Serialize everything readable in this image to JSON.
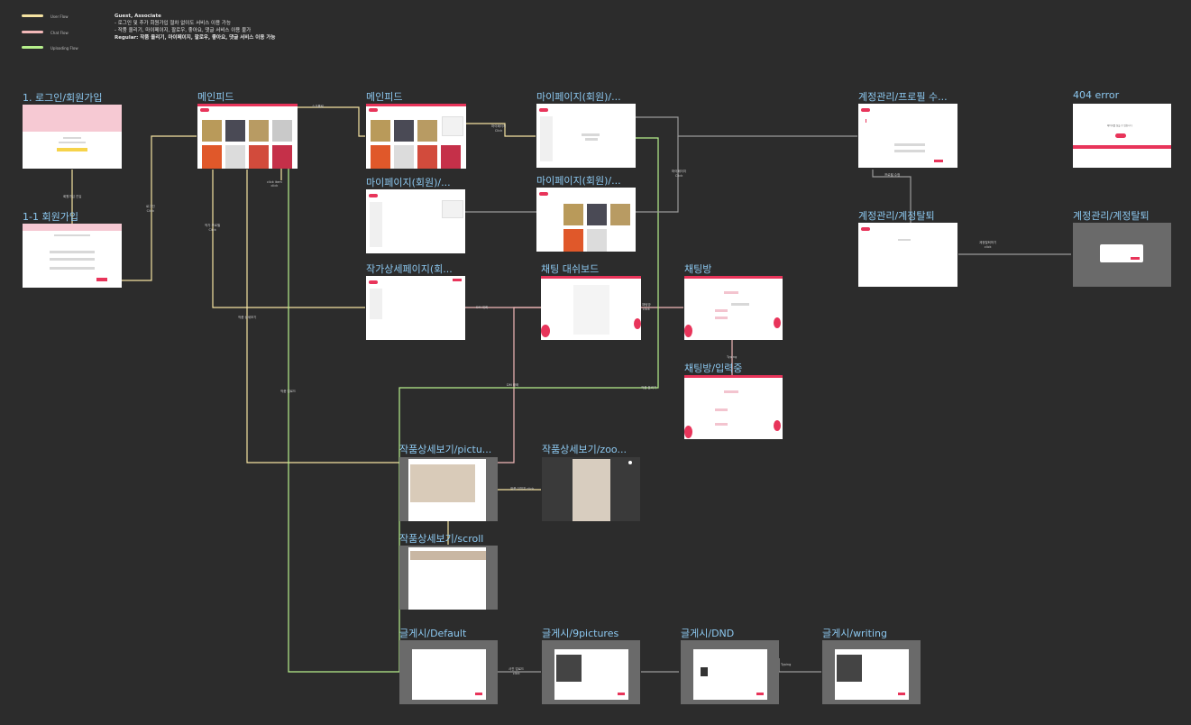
{
  "legend": [
    {
      "label": "User Flow",
      "color": "#f5e3a1"
    },
    {
      "label": "Chat Flow",
      "color": "#f2b8b8"
    },
    {
      "label": "Uploading Flow",
      "color": "#b7f08c"
    }
  ],
  "notes": {
    "line1": "Guest, Associate",
    "line2": "- 로그인 및 추가 회원가입 절차 없이도 서비스 이용 가능",
    "line3": "- 작품 올리기, 마이페이지, 팔로우, 좋아요, 댓글 서비스 이용 불가",
    "line4": "Regular: 작품 올리기, 마이페이지, 팔로우, 좋아요, 댓글 서비스 이용 가능"
  },
  "frames": {
    "login": "1. 로그인/회원가입",
    "signup": "1-1 회원가입",
    "main1": "메인피드",
    "main2": "메인피드",
    "mypage1": "마이페이지(회원)/...",
    "mypage2": "마이페이지(회원)/...",
    "mypage3": "마이페이지(회원)/...",
    "artist": "작가상세페이지(회...",
    "account_profile": "계정관리/프로필 수...",
    "error404": "404 error",
    "withdraw1": "계정관리/계정탈퇴",
    "withdraw2": "계정관리/계정탈퇴",
    "chat_dash": "채팅 대쉬보드",
    "chatroom": "채팅방",
    "chat_typing": "채팅방/입력중",
    "detail_picture": "작품상세보기/pictu...",
    "detail_zoom": "작품상세보기/zoo...",
    "detail_scroll": "작품상세보기/scroll",
    "post_default": "글게시/Default",
    "post_9": "글게시/9pictures",
    "post_dnd": "글게시/DND",
    "post_writing": "글게시/writing"
  },
  "connector_labels": {
    "c1": "회원가입 진입",
    "c2": "로그인\nClick",
    "c3": "스크롤링",
    "c4": "마이페이지\nClick",
    "c5": "작가 프로필\nClick",
    "c6": "click item\nclick",
    "c7": "마이페이지\nClick",
    "c8": "채팅방\nclick",
    "c9": "DM 대화",
    "c10": "Typing",
    "c11": "프로필 수정",
    "c12": "계정탈퇴하기\nclick",
    "c13": "작품 이미지 click",
    "c14": "사진 업로드\nclick",
    "c15": "DND",
    "c16": "Typing",
    "c17": "작품 상세보기",
    "c18": "작품 업로드",
    "c19": "작품 올리기",
    "c20": "DM 대화"
  },
  "error_text": "페이지를 찾을 수 없습니다"
}
